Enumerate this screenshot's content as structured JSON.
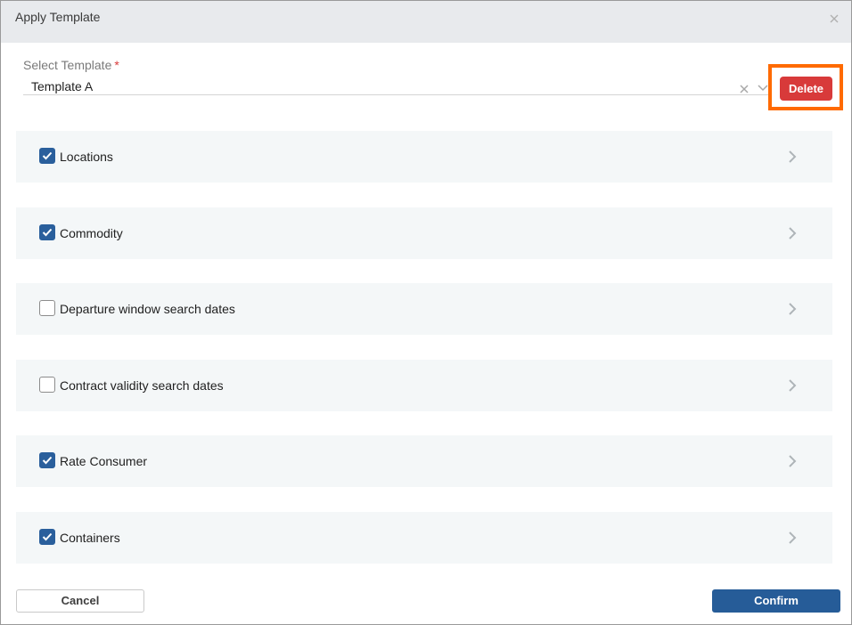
{
  "dialog": {
    "title": "Apply Template",
    "close_icon": "close-icon"
  },
  "template_select": {
    "label": "Select Template",
    "required_mark": "*",
    "value": "Template A",
    "clear_icon": "clear-icon",
    "dropdown_icon": "chevron-down-icon",
    "delete_label": "Delete"
  },
  "sections": [
    {
      "label": "Locations",
      "checked": true
    },
    {
      "label": "Commodity",
      "checked": true
    },
    {
      "label": "Departure window search dates",
      "checked": false
    },
    {
      "label": "Contract validity search dates",
      "checked": false
    },
    {
      "label": "Rate Consumer",
      "checked": true
    },
    {
      "label": "Containers",
      "checked": true
    }
  ],
  "footer": {
    "cancel_label": "Cancel",
    "confirm_label": "Confirm"
  },
  "colors": {
    "accent": "#2a5f9c",
    "delete": "#d83a3a",
    "highlight": "#ff6a00",
    "section_bg": "#f4f7f8",
    "header_bg": "#e8eaed"
  }
}
